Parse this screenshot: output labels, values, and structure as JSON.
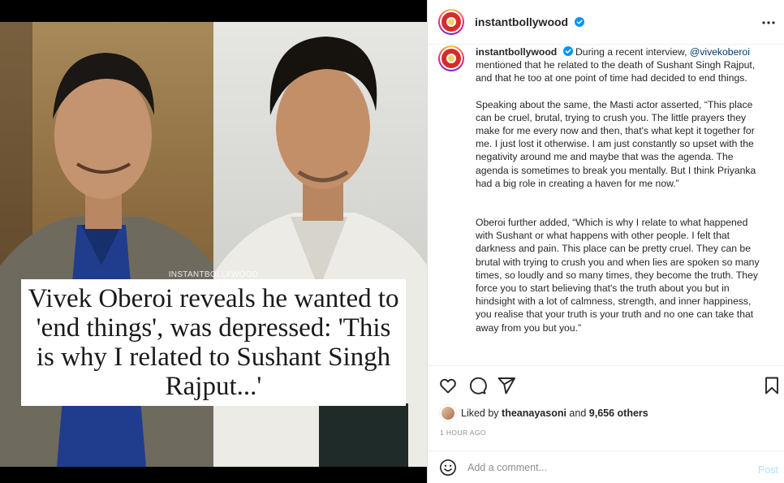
{
  "post": {
    "watermark": "INSTANTBOLLYWOOD",
    "headline": "Vivek Oberoi reveals he wanted to 'end things', was depressed: 'This is why I related to Sushant Singh Rajput...'"
  },
  "header": {
    "username": "instantbollywood"
  },
  "caption": {
    "username": "instantbollywood",
    "intro": "During a recent interview, ",
    "mention": "@vivekoberoi",
    "intro_rest": " mentioned that he related to the death of Sushant Singh Rajput, and that he too at one point of time had decided to end things.",
    "para2": "Speaking about the same, the Masti actor asserted, “This place can be cruel, brutal, trying to crush you. The little prayers they make for me every now and then, that's what kept it together for me. I just lost it otherwise. I am just constantly so upset with the negativity around me and maybe that was the agenda. The agenda is sometimes to break you mentally. But I think Priyanka had a big role in creating a haven for me now.”",
    "para3": "Oberoi further added, “Which is why I relate to what happened with Sushant or what happens with other people. I felt that darkness and pain. This place can be pretty cruel. They can be brutal with trying to crush you and when lies are spoken so many times, so loudly and so many times, they become the truth. They force you to start believing that's the truth about you but in hindsight with a lot of calmness, strength, and inner happiness, you realise that your truth is your truth and no one can take that away from you but you.”"
  },
  "likes": {
    "prefix": "Liked by ",
    "user": "theanayasoni",
    "middle": " and ",
    "others": "9,656 others"
  },
  "timestamp": "1 HOUR AGO",
  "comment": {
    "placeholder": "Add a comment...",
    "post_label": "Post"
  },
  "colors": {
    "verified": "#0095f6",
    "mention": "#00376b",
    "post_disabled": "#b2dffc"
  },
  "icons": [
    "more-icon",
    "verified-icon",
    "heart-icon",
    "comment-icon",
    "share-icon",
    "bookmark-icon",
    "emoji-icon"
  ]
}
